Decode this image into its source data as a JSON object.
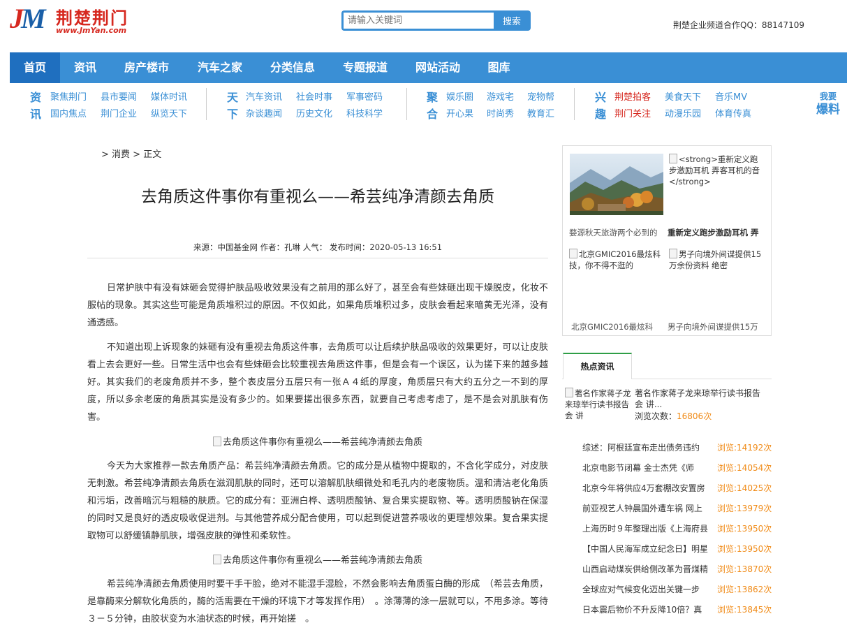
{
  "header": {
    "logo_j": "J",
    "logo_m": "M",
    "site_name": "荆楚荆门",
    "site_url": "www.JmYan.com",
    "search_placeholder": "请输入关键词",
    "search_button": "搜索",
    "qq_text": "荆楚企业频道合作QQ：88147109"
  },
  "nav": {
    "items": [
      "首页",
      "资讯",
      "房产楼市",
      "汽车之家",
      "分类信息",
      "专题报道",
      "网站活动",
      "图库"
    ],
    "active_index": 0
  },
  "subnav": {
    "groups": [
      {
        "head": [
          "资",
          "讯"
        ],
        "row1": [
          "聚焦荆门",
          "县市要闻",
          "媒体时讯"
        ],
        "row2": [
          "国内焦点",
          "荆门企业",
          "纵览天下"
        ]
      },
      {
        "head": [
          "天",
          "下"
        ],
        "row1": [
          "汽车资讯",
          "社会时事",
          "军事密码"
        ],
        "row2": [
          "杂谈趣闻",
          "历史文化",
          "科技科学"
        ]
      },
      {
        "head": [
          "聚",
          "合"
        ],
        "row1": [
          "娱乐圈",
          "游戏宅",
          "宠物帮"
        ],
        "row2": [
          "开心果",
          "时尚秀",
          "教育汇"
        ]
      },
      {
        "head": [
          "兴",
          "趣"
        ],
        "row1": [
          "荆楚拍客",
          "美食天下",
          "音乐MV"
        ],
        "row2": [
          "荆门关注",
          "动漫乐园",
          "体育传真"
        ]
      }
    ],
    "baoliao_line1": "我要",
    "baoliao_line2": "爆料"
  },
  "article": {
    "breadcrumb": [
      "> 消费",
      "> 正文"
    ],
    "title": "去角质这件事你有重视么——希芸纯净清颜去角质",
    "meta": "来源：中国基金网 作者：孔琳 人气： 发布时间：2020-05-13 16:51",
    "paragraphs": [
      "日常护肤中有没有妹砸会觉得护肤品吸收效果没有之前用的那么好了，甚至会有些妹砸出现干燥脱皮，化妆不服帖的现象。其实这些可能是角质堆积过的原因。不仅如此，如果角质堆积过多，皮肤会看起来暗黄无光泽，没有通透感。",
      "不知道出现上诉现象的妹砸有没有重视去角质这件事，去角质可以让后续护肤品吸收的效果更好，可以让皮肤看上去会更好一些。日常生活中也会有些妹砸会比较重视去角质这件事，但是会有一个误区，认为搓下来的越多越好。其实我们的老废角质并不多，整个表皮层分五层只有一张Ａ４纸的厚度，角质层只有大约五分之一不到的厚度，所以多余老废的角质其实是没有多少的。如果要搓出很多东西，就要自己考虑考虑了，是不是会对肌肤有伤害。",
      "今天为大家推荐一款去角质产品：希芸纯净清颜去角质。它的成分是从植物中提取的，不含化学成分，对皮肤无刺激。希芸纯净清颜去角质在滋润肌肤的同时，还可以溶解肌肤细微处和毛孔内的老废物质。温和清洁老化角质和污垢，改善暗沉与粗糙的肤质。它的成分有：亚洲白桦、透明质酸钠、复合果实提取物、等。透明质酸钠在保湿的同时又是良好的透皮吸收促进剂。与其他营养成分配合使用，可以起到促进营养吸收的更理想效果。复合果实提取物可以舒缓镇静肌肤，增强皮肤的弹性和柔软性。",
      "希芸纯净清颜去角质使用时要干手干脸，绝对不能湿手湿脸，不然会影响去角质蛋白酶的形成　（希芸去角质，是靠酶来分解软化角质的，酶的活需要在干燥的环境下才等发挥作用）　。涂薄薄的涂一层就可以，不用多涂。等待３－５分钟，由胶状变为水油状态的时候，再开始搓　。"
    ],
    "image_alt_1": "去角质这件事你有重视么——希芸纯净清颜去角质",
    "image_alt_2": "去角质这件事你有重视么——希芸纯净清颜去角质"
  },
  "sidebar": {
    "box": {
      "alt_top_right": "<strong>重新定义跑步激励耳机 弄客耳机的音</strong>",
      "cap_1": "婺源秋天旅游两个必到的",
      "cap_2": "重新定义跑步激励耳机 弄",
      "alt_bottom_left": "北京GMIC2016最炫科技，你不得不逛的",
      "alt_bottom_right": "男子向境外间谍提供15万余份资料 绝密",
      "cap_3": "北京GMIC2016最炫科",
      "cap_4": "男子向境外间谍提供15万"
    },
    "hot": {
      "tab_label": "热点资讯",
      "featured_alt": "著名作家蒋子龙来琼举行读书报告会 讲",
      "featured_title": "著名作家蒋子龙来琼举行读书报告会 讲...",
      "featured_views_label": "浏览次数：",
      "featured_views": "16806次",
      "items": [
        {
          "title": "综述：阿根廷宣布走出债务违约",
          "views": "浏览:14192次"
        },
        {
          "title": "北京电影节闭幕 金士杰凭《师",
          "views": "浏览:14054次"
        },
        {
          "title": "北京今年将供应4万套棚改安置房",
          "views": "浏览:14025次"
        },
        {
          "title": "前亚视艺人钟晨国外遭车祸 网上",
          "views": "浏览:13979次"
        },
        {
          "title": "上海历时９年整理出版《上海府县",
          "views": "浏览:13950次"
        },
        {
          "title": "【中国人民海军成立纪念日】明星",
          "views": "浏览:13950次"
        },
        {
          "title": "山西启动煤炭供给侧改革为晋煤精",
          "views": "浏览:13870次"
        },
        {
          "title": "全球应对气候变化迈出关键一步",
          "views": "浏览:13862次"
        },
        {
          "title": "日本震后物价不升反降10倍？真",
          "views": "浏览:13845次"
        }
      ]
    }
  }
}
